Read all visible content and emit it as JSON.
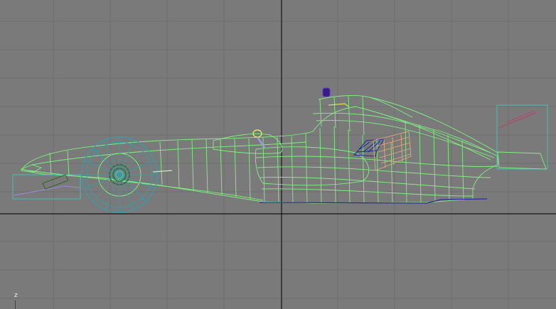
{
  "viewport": {
    "background": "#7a7a7a",
    "grid_color": "#6e6e6e",
    "axis_color": "#141414",
    "gizmo_axis_label": "z"
  },
  "model": {
    "wireframe_color": "#7ff07f",
    "wheel_color": "#2fa0b0",
    "selection_box_color": "#3fc8c0",
    "marker_colors": {
      "driver_helmet": "#3a1a8a",
      "mirror_light": "#f0f060",
      "suspension_node": "#1a2aa0",
      "sidepod_detail": "#e8a878",
      "rear_wing_detail": "#c03a6a",
      "floor_line": "#2a2aa0"
    }
  }
}
